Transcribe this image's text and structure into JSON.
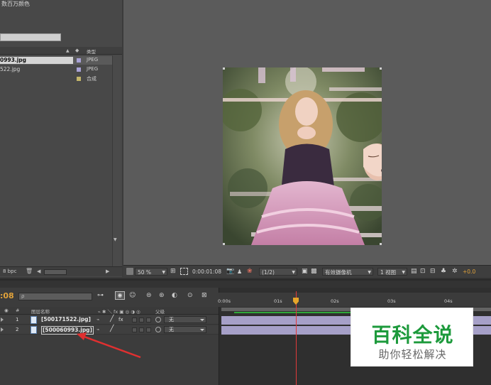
{
  "project_panel": {
    "header_text": "数百万颜色",
    "column_type": "类型",
    "items": [
      {
        "name": "0993.jpg",
        "type": "JPEG",
        "swatch": "#a9a2d6",
        "selected": true
      },
      {
        "name": "522.jpg",
        "type": "JPEG",
        "swatch": "#a9a2d6",
        "selected": false
      },
      {
        "name": "",
        "type": "合成",
        "swatch": "#c3b56a",
        "selected": false
      }
    ],
    "bpc": "8 bpc"
  },
  "viewer_toolbar": {
    "zoom": "50 %",
    "timecode": "0:00:01:08",
    "resolution": "(1/2)",
    "camera": "有效摄像机",
    "views": "1 视图",
    "exposure": "+0.0"
  },
  "timeline": {
    "timecode": ":08",
    "search_icon": "search-icon",
    "columns": {
      "number": "#",
      "layer_name": "图层名称",
      "parent": "父级"
    },
    "ruler": [
      "0:00s",
      "01s",
      "02s",
      "03s",
      "04s"
    ],
    "layers": [
      {
        "num": "1",
        "name": "[500171522.jpg]",
        "fx": "fx",
        "parent": "无",
        "boxed": false
      },
      {
        "num": "2",
        "name": "[500060993.jpg]",
        "fx": "",
        "parent": "无",
        "boxed": true
      }
    ]
  },
  "watermark": {
    "title": "百科全说",
    "subtitle": "助你轻松解决"
  },
  "colors": {
    "track_purple": "#a6a0c8",
    "playhead": "#e23a3a",
    "timecode": "#e2a33a",
    "watermark_green": "#1d9a3c"
  }
}
